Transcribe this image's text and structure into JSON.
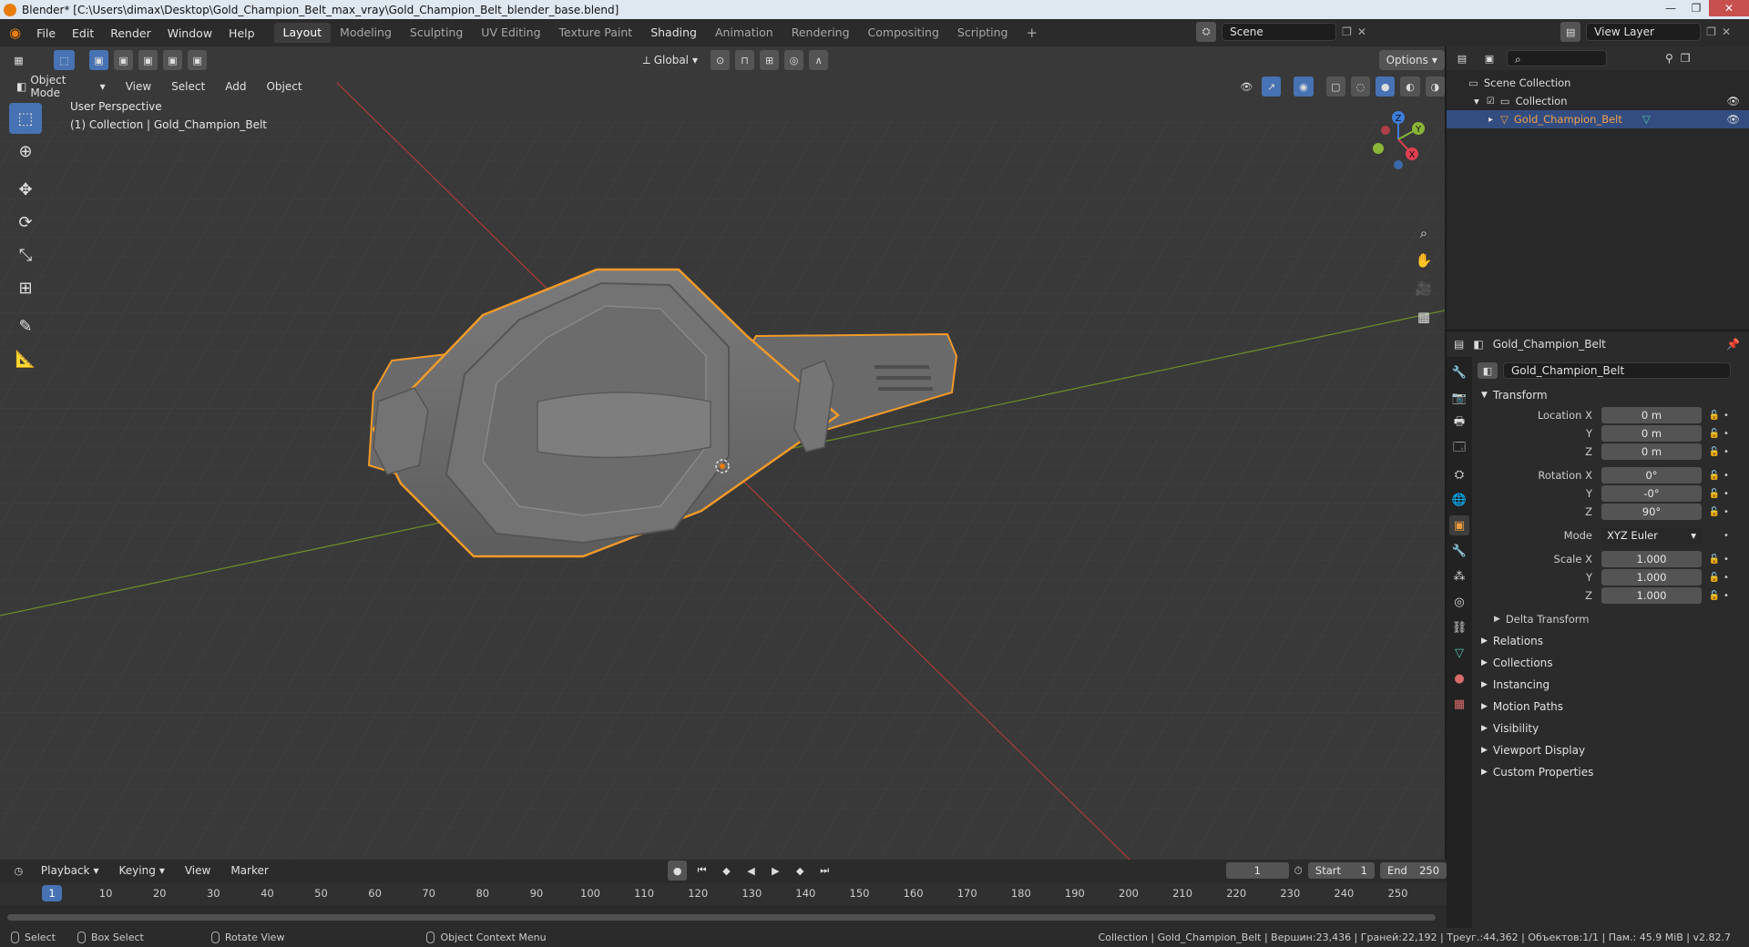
{
  "window": {
    "title": "Blender* [C:\\Users\\dimax\\Desktop\\Gold_Champion_Belt_max_vray\\Gold_Champion_Belt_blender_base.blend]"
  },
  "menu": [
    "File",
    "Edit",
    "Render",
    "Window",
    "Help"
  ],
  "workspaces": [
    "Layout",
    "Modeling",
    "Sculpting",
    "UV Editing",
    "Texture Paint",
    "Shading",
    "Animation",
    "Rendering",
    "Compositing",
    "Scripting"
  ],
  "scene": {
    "name": "Scene",
    "view_layer": "View Layer"
  },
  "viewport": {
    "transform_orientation": "Global",
    "options_label": "Options",
    "mode": "Object Mode",
    "menus": [
      "View",
      "Select",
      "Add",
      "Object"
    ],
    "info_line1": "User Perspective",
    "info_line2": "(1) Collection | Gold_Champion_Belt",
    "gizmo_axes": {
      "x": "X",
      "y": "Y",
      "z": "Z"
    }
  },
  "outliner": {
    "root": "Scene Collection",
    "collection": "Collection",
    "object": "Gold_Champion_Belt"
  },
  "properties": {
    "header_object": "Gold_Champion_Belt",
    "object_name": "Gold_Champion_Belt",
    "transform_title": "Transform",
    "location_label": "Location X",
    "location": [
      "0 m",
      "0 m",
      "0 m"
    ],
    "rotation_label": "Rotation X",
    "rotation": [
      "0°",
      "-0°",
      "90°"
    ],
    "axis_y": "Y",
    "axis_z": "Z",
    "mode_label": "Mode",
    "mode_value": "XYZ Euler",
    "scale_label": "Scale X",
    "scale": [
      "1.000",
      "1.000",
      "1.000"
    ],
    "delta_transform": "Delta Transform",
    "sections": [
      "Relations",
      "Collections",
      "Instancing",
      "Motion Paths",
      "Visibility",
      "Viewport Display",
      "Custom Properties"
    ]
  },
  "timeline": {
    "menus": [
      "Playback",
      "Keying",
      "View",
      "Marker"
    ],
    "current_frame": "1",
    "start_label": "Start",
    "start": "1",
    "end_label": "End",
    "end": "250",
    "ruler_ticks": [
      "10",
      "20",
      "30",
      "40",
      "50",
      "60",
      "70",
      "80",
      "90",
      "100",
      "110",
      "120",
      "130",
      "140",
      "150",
      "160",
      "170",
      "180",
      "190",
      "200",
      "210",
      "220",
      "230",
      "240",
      "250"
    ],
    "ruler_current": "1"
  },
  "status": {
    "select": "Select",
    "box_select": "Box Select",
    "rotate_view": "Rotate View",
    "context_menu": "Object Context Menu",
    "stats": "Collection | Gold_Champion_Belt | Вершин:23,436 | Граней:22,192 | Треуг.:44,362 | Объектов:1/1 | Пам.: 45.9 MiB | v2.82.7"
  }
}
